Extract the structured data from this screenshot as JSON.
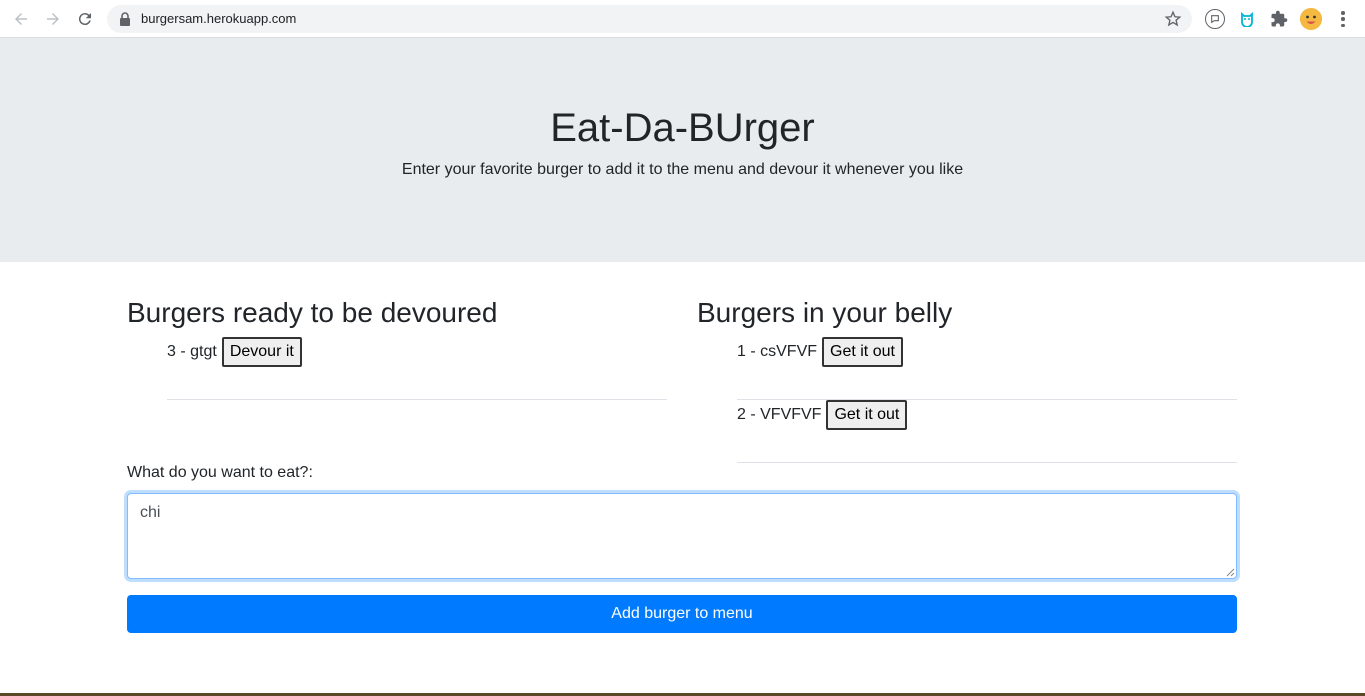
{
  "browser": {
    "url": "burgersam.herokuapp.com"
  },
  "jumbotron": {
    "title": "Eat-Da-BUrger",
    "subtitle": "Enter your favorite burger to add it to the menu and devour it whenever you like"
  },
  "ready": {
    "heading": "Burgers ready to be devoured",
    "items": [
      {
        "text": "3 - gtgt",
        "button": "Devour it"
      }
    ]
  },
  "devoured": {
    "heading": "Burgers in your belly",
    "items": [
      {
        "text": "1 - csVFVF",
        "button": "Get it out"
      },
      {
        "text": "2 - VFVFVF",
        "button": "Get it out"
      }
    ]
  },
  "form": {
    "label": "What do you want to eat?:",
    "value": "chi",
    "submit": "Add burger to menu"
  }
}
